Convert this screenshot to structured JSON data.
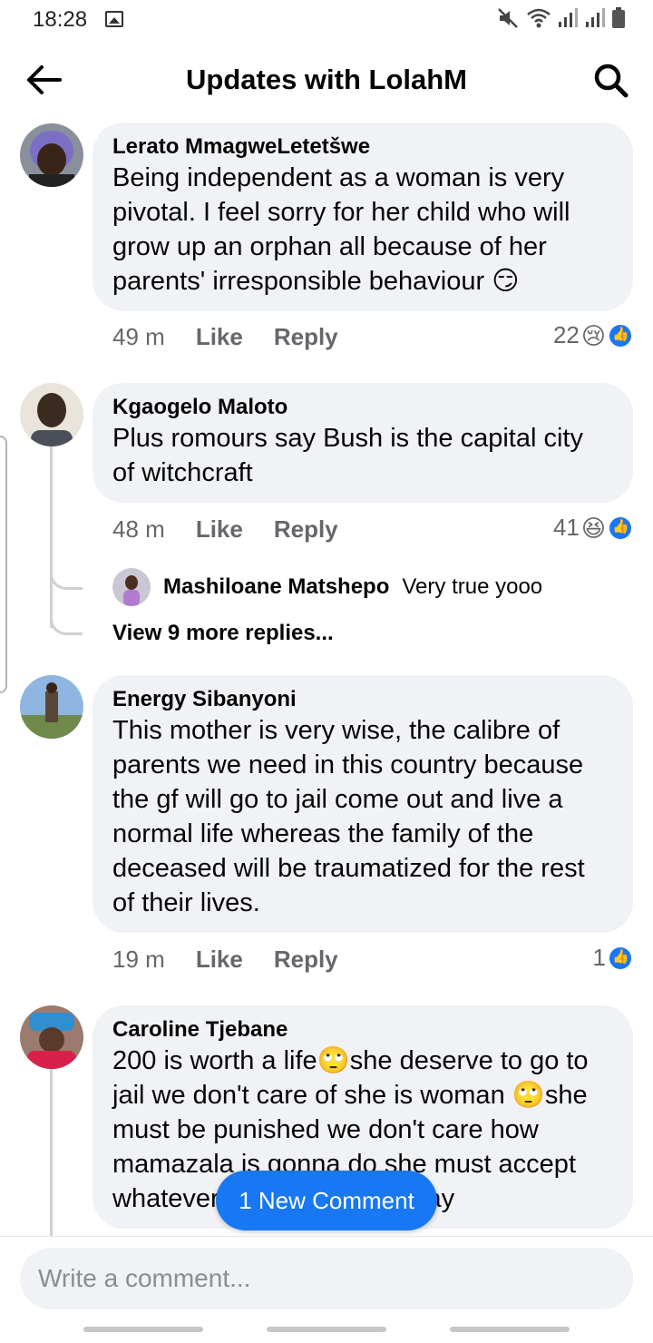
{
  "status_bar": {
    "time": "18:28",
    "icons": [
      "gallery-icon",
      "mute-icon",
      "wifi-icon",
      "signal-icon",
      "signal-icon",
      "battery-icon"
    ]
  },
  "header": {
    "title": "Updates with LolahM",
    "back_icon": "arrow-left-icon",
    "search_icon": "search-icon"
  },
  "comments": [
    {
      "author": "Lerato MmagweLetetšwe",
      "lines": [
        "Being independent as a woman is very",
        "pivotal. I feel sorry for her child who will",
        "grow up an orphan all because of her",
        "parents' irresponsible behaviour 😏"
      ],
      "time": "49 m",
      "like_label": "Like",
      "reply_label": "Reply",
      "reaction_count": "22",
      "reactions": [
        "😢",
        "like"
      ]
    },
    {
      "author": "Kgaogelo Maloto",
      "lines": [
        "Plus romours say Bush is the capital city",
        "of witchcraft"
      ],
      "time": "48 m",
      "like_label": "Like",
      "reply_label": "Reply",
      "reaction_count": "41",
      "reactions": [
        "😆",
        "like"
      ],
      "reply_preview": {
        "author": "Mashiloane Matshepo",
        "text": "Very true yooo"
      },
      "view_more": "View 9 more replies..."
    },
    {
      "author": "Energy Sibanyoni",
      "lines": [
        "This mother is very wise,  the calibre of",
        "parents we need in this country because",
        "the gf will go to jail come out and live a",
        "normal life whereas the family of the",
        "deceased will be traumatized for the rest",
        "of their lives."
      ],
      "time": "19 m",
      "like_label": "Like",
      "reply_label": "Reply",
      "reaction_count": "1",
      "reactions": [
        "like"
      ]
    },
    {
      "author": "Caroline Tjebane",
      "lines": [
        "200 is worth a life🙄she deserve to go to",
        "jail we don't care of she is woman 🙄she",
        "must be punished we don't  care how",
        "mamazala is gonna do she must accept",
        "whatever that comes her way"
      ]
    }
  ],
  "new_comment_pill": "1 New Comment",
  "composer": {
    "placeholder": "Write a comment..."
  },
  "colors": {
    "accent": "#1877f2",
    "bubble": "#f0f2f5",
    "meta_text": "#65676b"
  }
}
